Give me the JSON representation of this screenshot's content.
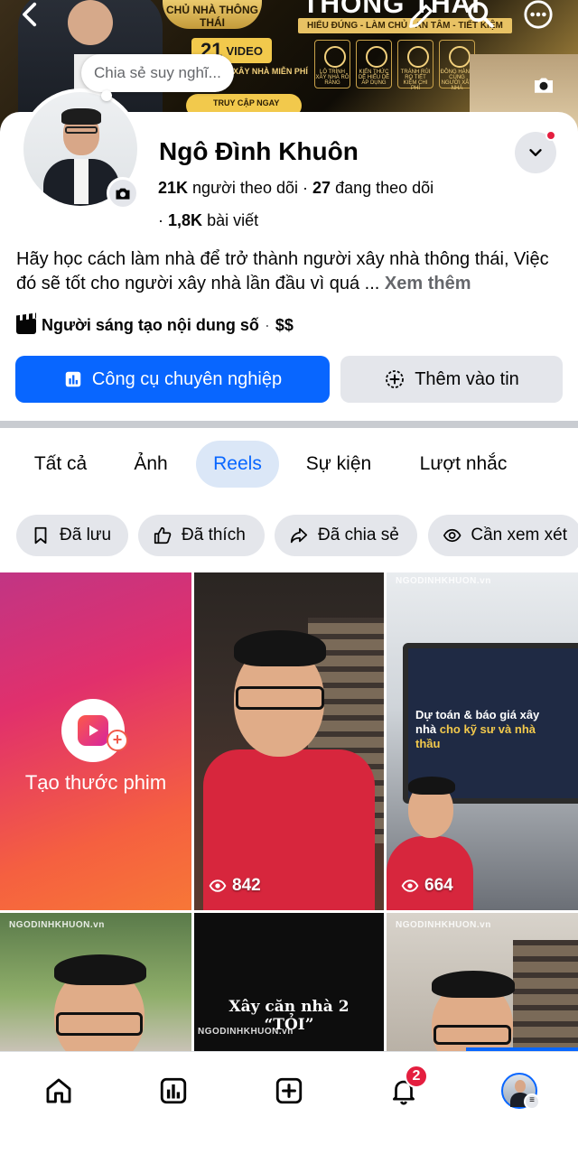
{
  "cover": {
    "brand": "CHỦ NHÀ THÔNG THÁI",
    "headline": "THÔNG THÁI",
    "slogan": "HIỂU ĐÚNG - LÀM CHỦ - AN TÂM - TIẾT KIỆM",
    "video_prefix": "21",
    "video_label": "VIDEO",
    "free_text": "XÂY NHÀ MIỄN PHÍ",
    "features": [
      "LỘ TRÌNH XÂY NHÀ RÕ RÀNG",
      "KIẾN THỨC DỄ HIỂU DỄ ÁP DỤNG",
      "TRÁNH RỦI RO TIẾT KIỆM CHI PHÍ",
      "ĐỒNG HÀNH CÙNG NGƯỜI XÂY NHÀ"
    ],
    "access": "TRUY CẬP NGAY"
  },
  "thought_bubble": "Chia sẻ suy nghĩ...",
  "profile": {
    "name": "Ngô Đình Khuôn",
    "followers_count": "21K",
    "followers_label": "người theo dõi",
    "following_count": "27",
    "following_label": "đang theo dõi",
    "posts_count": "1,8K",
    "posts_label": "bài viết",
    "bio": "Hãy học cách làm nhà để trở thành người xây nhà thông thái, Việc đó sẽ tốt cho người xây nhà lần đầu vì quá ...",
    "see_more": "Xem thêm",
    "creator_label": "Người sáng tạo nội dung số",
    "creator_price": "$$"
  },
  "buttons": {
    "pro_tools": "Công cụ chuyên nghiệp",
    "add_to_story": "Thêm vào tin"
  },
  "tabs": [
    "Tất cả",
    "Ảnh",
    "Reels",
    "Sự kiện",
    "Lượt nhắc"
  ],
  "active_tab": "Reels",
  "chips": [
    "Đã lưu",
    "Đã thích",
    "Đã chia sẻ",
    "Cần xem xét"
  ],
  "reels": {
    "create_label": "Tạo thước phim",
    "watermark": "NGODINHKHUON.vn",
    "items": [
      {
        "views": "842"
      },
      {
        "views": "664",
        "screen_title": "Dự toán & báo giá xây nhà",
        "screen_title_gold": "cho kỹ sư và nhà thầu"
      },
      {
        "caption": "Xây căn nhà 2 “TỎI”"
      }
    ]
  },
  "nav": {
    "notifications_badge": "2"
  },
  "colors": {
    "primary": "#0866ff",
    "badge_red": "#e41e3f",
    "chip_bg": "#e4e6eb"
  },
  "icons": [
    "back-icon",
    "edit-icon",
    "search-icon",
    "more-icon",
    "camera-icon",
    "chevron-down-icon",
    "chart-icon",
    "add-circle-icon",
    "bookmark-icon",
    "thumbs-up-icon",
    "share-icon",
    "eye-icon",
    "home-icon",
    "dashboard-icon",
    "create-icon",
    "bell-icon"
  ]
}
